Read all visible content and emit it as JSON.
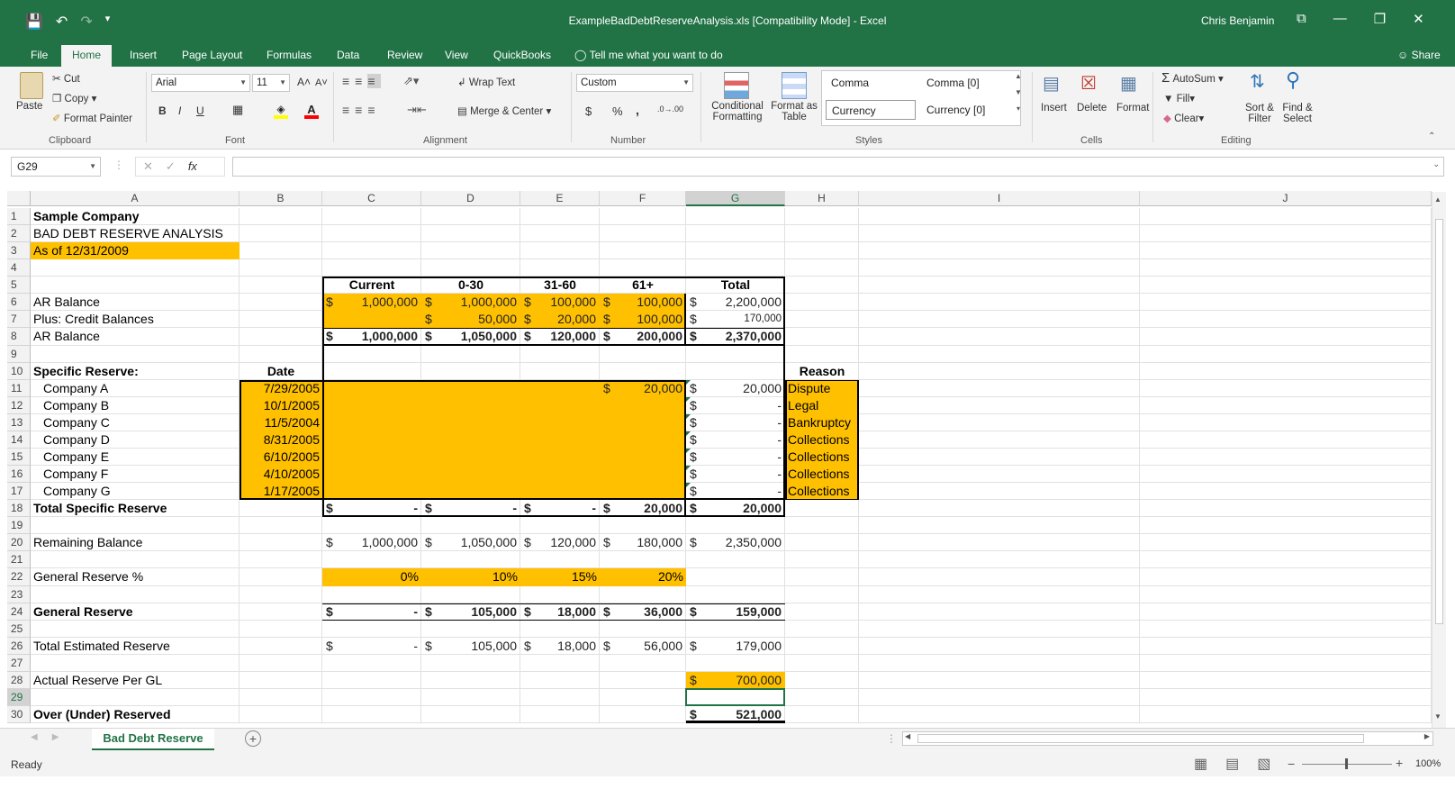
{
  "window": {
    "title": "ExampleBadDebtReserveAnalysis.xls  [Compatibility Mode]  -  Excel",
    "user": "Chris Benjamin",
    "qat_save": "💾",
    "qat_undo": "↶",
    "qat_redo": "↷",
    "qat_more": "▾",
    "btn_options": "⧉",
    "btn_min": "—",
    "btn_restore": "❐",
    "btn_close": "✕"
  },
  "tabs": [
    "File",
    "Home",
    "Insert",
    "Page Layout",
    "Formulas",
    "Data",
    "Review",
    "View",
    "QuickBooks"
  ],
  "tell_me": "Tell me what you want to do",
  "share": "Share",
  "ribbon": {
    "clipboard": {
      "paste": "Paste",
      "cut": "Cut",
      "copy": "Copy",
      "format_painter": "Format Painter",
      "label": "Clipboard"
    },
    "font": {
      "name": "Arial",
      "size": "11",
      "label": "Font",
      "bold": "B",
      "italic": "I",
      "underline": "U",
      "grow": "A˄",
      "shrink": "A˅"
    },
    "alignment": {
      "wrap": "Wrap Text",
      "merge": "Merge & Center",
      "label": "Alignment"
    },
    "number": {
      "format": "Custom",
      "label": "Number",
      "currency": "$",
      "percent": "%",
      "comma": ",",
      "inc_dec": ".0→.00",
      "dec_dec": ".00→.0"
    },
    "styles": {
      "cond1": "Conditional",
      "cond2": "Formatting",
      "table1": "Format as",
      "table2": "Table",
      "comma": "Comma",
      "comma0": "Comma [0]",
      "currency": "Currency",
      "currency0": "Currency [0]",
      "label": "Styles"
    },
    "cells": {
      "insert": "Insert",
      "delete": "Delete",
      "format": "Format",
      "label": "Cells"
    },
    "editing": {
      "autosum": "AutoSum",
      "fill": "Fill",
      "clear": "Clear",
      "sort1": "Sort &",
      "sort2": "Filter",
      "find1": "Find &",
      "find2": "Select",
      "label": "Editing"
    }
  },
  "formula_bar": {
    "name_box": "G29",
    "cancel": "✕",
    "enter": "✓",
    "fx": "fx"
  },
  "columns": [
    "A",
    "B",
    "C",
    "D",
    "E",
    "F",
    "G",
    "H",
    "I",
    "J"
  ],
  "rows": [
    "1",
    "2",
    "3",
    "4",
    "5",
    "6",
    "7",
    "8",
    "9",
    "10",
    "11",
    "12",
    "13",
    "14",
    "15",
    "16",
    "17",
    "18",
    "19",
    "20",
    "21",
    "22",
    "23",
    "24",
    "25",
    "26",
    "27",
    "28",
    "29",
    "30"
  ],
  "sheet": {
    "a1": "Sample Company",
    "a2": "BAD DEBT RESERVE ANALYSIS",
    "a3": "As of 12/31/2009",
    "headers": [
      "Current",
      "0-30",
      "31-60",
      "61+",
      "Total"
    ],
    "a6": "AR Balance",
    "a7": "Plus: Credit Balances",
    "a8": "AR Balance",
    "a10": "Specific Reserve:",
    "b10": "Date",
    "h10": "Reason",
    "companies": [
      {
        "name": "Company A",
        "date": "7/29/2005",
        "f": "20,000",
        "g": "20,000",
        "reason": "Dispute"
      },
      {
        "name": "Company B",
        "date": "10/1/2005",
        "f": "",
        "g": "-",
        "reason": "Legal"
      },
      {
        "name": "Company C",
        "date": "11/5/2004",
        "f": "",
        "g": "-",
        "reason": "Bankruptcy"
      },
      {
        "name": "Company D",
        "date": "8/31/2005",
        "f": "",
        "g": "-",
        "reason": "Collections"
      },
      {
        "name": "Company E",
        "date": "6/10/2005",
        "f": "",
        "g": "-",
        "reason": "Collections"
      },
      {
        "name": "Company F",
        "date": "4/10/2005",
        "f": "",
        "g": "-",
        "reason": "Collections"
      },
      {
        "name": "Company G",
        "date": "1/17/2005",
        "f": "",
        "g": "-",
        "reason": "Collections"
      }
    ],
    "a18": "Total Specific Reserve",
    "a20": "Remaining Balance",
    "a22": "General Reserve %",
    "a24": "General Reserve",
    "a26": "Total Estimated Reserve",
    "a28": "Actual Reserve Per GL",
    "a30": "Over (Under) Reserved",
    "dollar": "$",
    "r6": [
      "1,000,000",
      "1,000,000",
      "100,000",
      "100,000",
      "2,200,000"
    ],
    "r7": [
      "",
      "50,000",
      "20,000",
      "100,000",
      "170,000"
    ],
    "r8": [
      "1,000,000",
      "1,050,000",
      "120,000",
      "200,000",
      "2,370,000"
    ],
    "r18": [
      "-",
      "-",
      "-",
      "20,000",
      "20,000"
    ],
    "r20": [
      "1,000,000",
      "1,050,000",
      "120,000",
      "180,000",
      "2,350,000"
    ],
    "r22": [
      "0%",
      "10%",
      "15%",
      "20%"
    ],
    "r24": [
      "-",
      "105,000",
      "18,000",
      "36,000",
      "159,000"
    ],
    "r26": [
      "-",
      "105,000",
      "18,000",
      "56,000",
      "179,000"
    ],
    "g28": "700,000",
    "g30": "521,000"
  },
  "sheet_tab": "Bad Debt Reserve",
  "status": "Ready",
  "zoom": "100%",
  "colors": {
    "excel_green": "#217346",
    "highlight": "#ffc000"
  }
}
